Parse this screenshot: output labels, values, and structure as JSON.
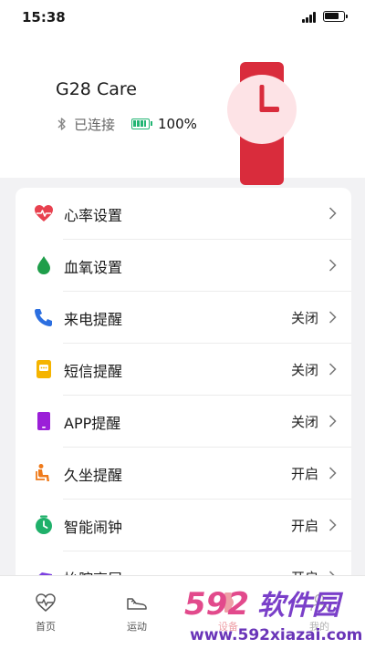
{
  "status_bar": {
    "time": "15:38"
  },
  "device": {
    "name": "G28 Care",
    "connection": "已连接",
    "battery": "100%",
    "battery_level": 1.0
  },
  "menu": {
    "items": [
      {
        "label": "心率设置",
        "value": "",
        "icon": "heart-rate-icon",
        "color": "#e8414f"
      },
      {
        "label": "血氧设置",
        "value": "",
        "icon": "drop-icon",
        "color": "#1f9e4a"
      },
      {
        "label": "来电提醒",
        "value": "关闭",
        "icon": "phone-icon",
        "color": "#2c6fe0"
      },
      {
        "label": "短信提醒",
        "value": "关闭",
        "icon": "message-icon",
        "color": "#f5b400"
      },
      {
        "label": "APP提醒",
        "value": "关闭",
        "icon": "app-icon",
        "color": "#9b1fd8"
      },
      {
        "label": "久坐提醒",
        "value": "开启",
        "icon": "sitting-icon",
        "color": "#ef7a1a"
      },
      {
        "label": "智能闹钟",
        "value": "开启",
        "icon": "alarm-icon",
        "color": "#1fb06a"
      },
      {
        "label": "抬腕亮屏",
        "value": "开启",
        "icon": "wrist-icon",
        "color": "#7b3fe0"
      }
    ]
  },
  "tabs": [
    {
      "label": "首页",
      "icon": "heart-pulse-icon"
    },
    {
      "label": "运动",
      "icon": "sneaker-icon"
    },
    {
      "label": "设备",
      "icon": "watch-icon"
    },
    {
      "label": "我的",
      "icon": "user-icon"
    }
  ],
  "watermark": {
    "brand": "592软件园",
    "url": "www.592xiazai.com"
  }
}
